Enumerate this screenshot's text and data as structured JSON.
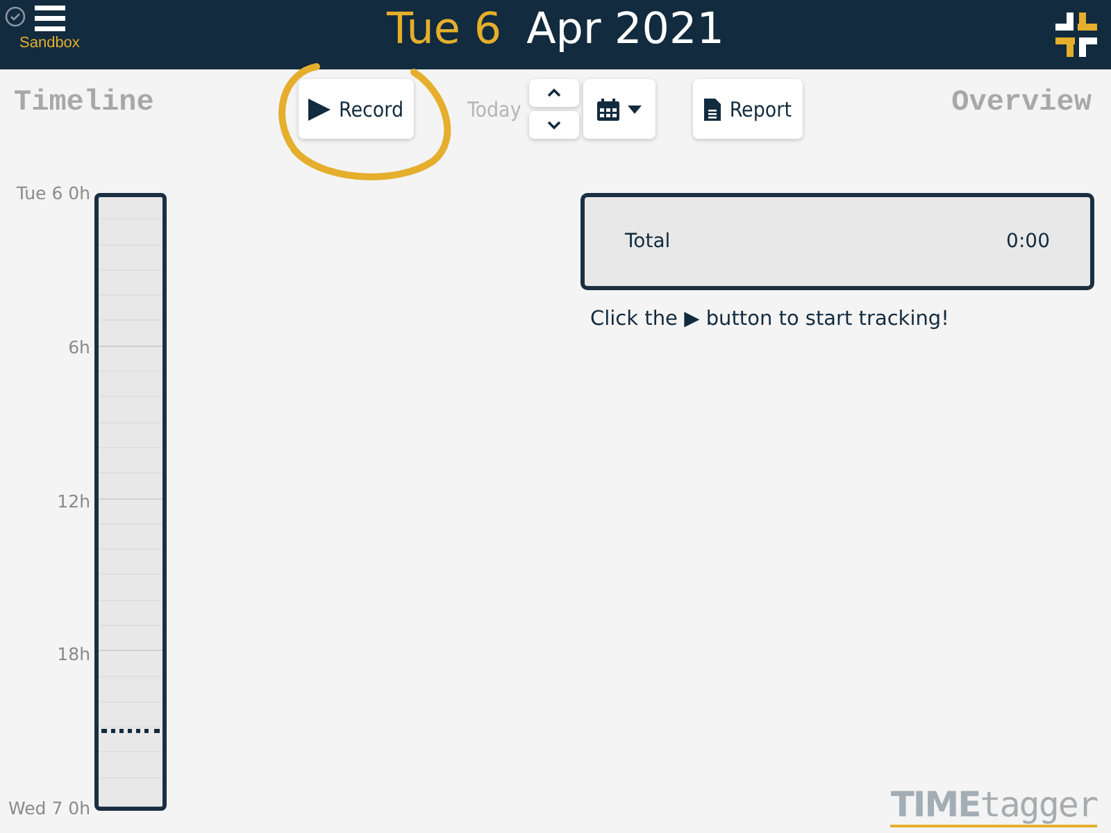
{
  "header": {
    "menu_label": "Sandbox",
    "day": "Tue 6",
    "month_year": "Apr 2021"
  },
  "toolbar": {
    "left_title": "Timeline",
    "right_title": "Overview",
    "buttons": [
      {
        "kind": "record",
        "label": "Record",
        "disabled": false
      },
      {
        "kind": "today",
        "label": "Today",
        "disabled": true
      },
      {
        "kind": "updown"
      },
      {
        "kind": "calendar"
      },
      {
        "kind": "report",
        "label": "Report",
        "disabled": false
      }
    ]
  },
  "timeline": {
    "labels": [
      "Tue 6 0h",
      "6h",
      "12h",
      "18h",
      "Wed 7 0h"
    ],
    "now": {
      "level": 0.88
    }
  },
  "overview": {
    "total_label": "Total",
    "total_value": "0:00",
    "hint": "Click the ▶ button to start tracking!"
  },
  "logo": {
    "part1": "TIME",
    "part2": "tagger"
  }
}
